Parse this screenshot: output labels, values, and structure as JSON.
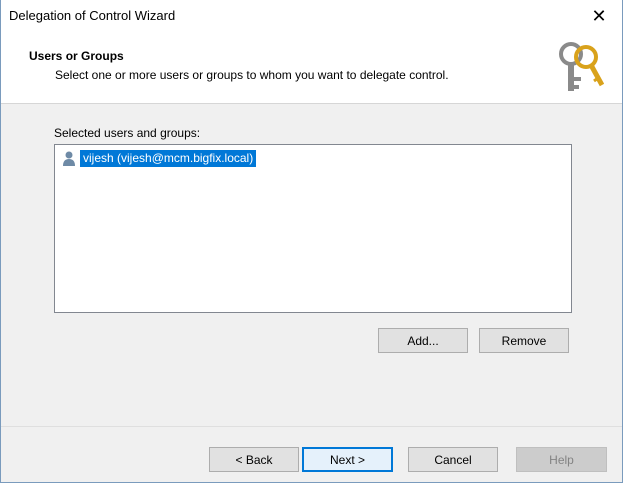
{
  "window": {
    "title": "Delegation of Control Wizard"
  },
  "header": {
    "title": "Users or Groups",
    "subtitle": "Select one or more users or groups to whom you want to delegate control."
  },
  "list": {
    "label": "Selected users and groups:",
    "items": [
      {
        "text": "vijesh (vijesh@mcm.bigfix.local)",
        "selected": true
      }
    ]
  },
  "buttons": {
    "add": "Add...",
    "remove": "Remove",
    "back": "< Back",
    "next": "Next >",
    "cancel": "Cancel",
    "help": "Help"
  },
  "colors": {
    "selection": "#0078d7",
    "primary_border": "#0078d7"
  },
  "icons": {
    "close": "close-icon",
    "header": "keys-icon",
    "user": "user-icon"
  }
}
